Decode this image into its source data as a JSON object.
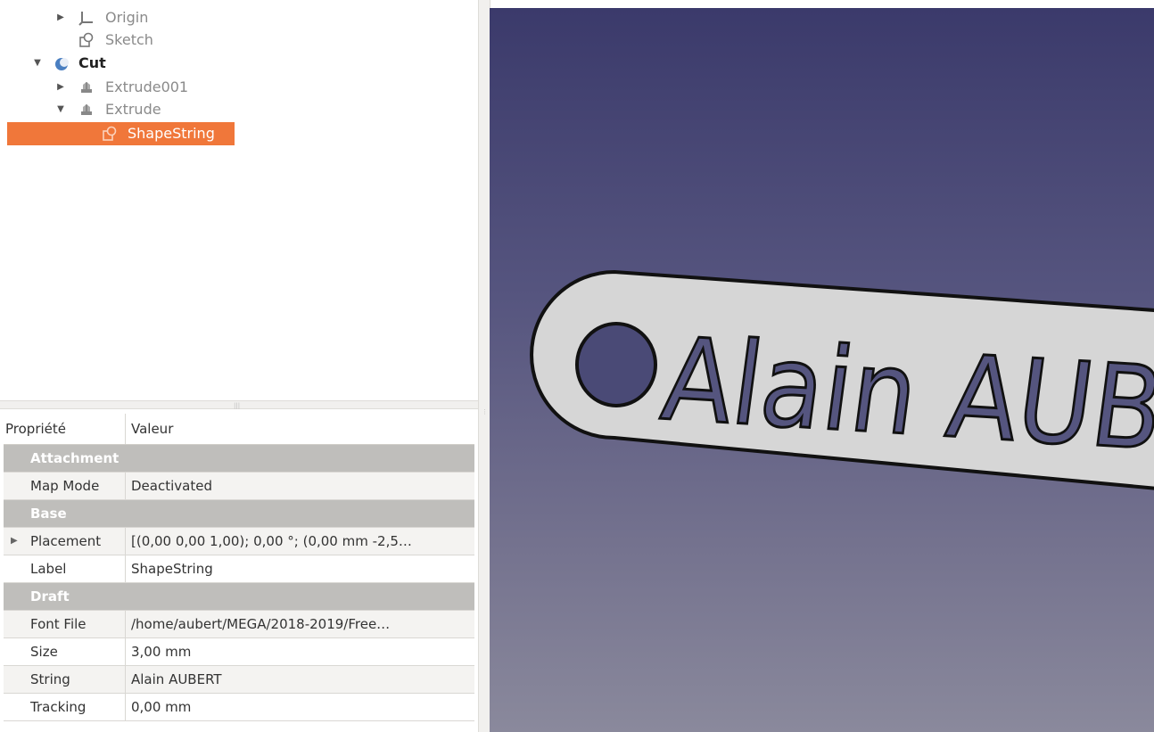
{
  "tree": {
    "items": [
      {
        "label": "Origin",
        "icon": "origin-icon",
        "expander": "▶"
      },
      {
        "label": "Sketch",
        "icon": "sketch-icon",
        "expander": ""
      },
      {
        "label": "Cut",
        "icon": "cut-icon",
        "expander": "▼"
      },
      {
        "label": "Extrude001",
        "icon": "extrude-icon",
        "expander": "▶"
      },
      {
        "label": "Extrude",
        "icon": "extrude-icon",
        "expander": "▼"
      },
      {
        "label": "ShapeString",
        "icon": "shapestring-icon",
        "expander": ""
      }
    ],
    "selected_color": "#f0773a"
  },
  "properties": {
    "header": {
      "property": "Propriété",
      "value": "Valeur"
    },
    "groups": [
      {
        "name": "Attachment",
        "rows": [
          {
            "name": "Map Mode",
            "value": "Deactivated"
          }
        ]
      },
      {
        "name": "Base",
        "rows": [
          {
            "name": "Placement",
            "value": "[(0,00 0,00 1,00); 0,00 °; (0,00 mm  -2,5…",
            "expander": "▶"
          },
          {
            "name": "Label",
            "value": "ShapeString"
          }
        ]
      },
      {
        "name": "Draft",
        "rows": [
          {
            "name": "Font File",
            "value": "/home/aubert/MEGA/2018-2019/Free…"
          },
          {
            "name": "Size",
            "value": "3,00 mm"
          },
          {
            "name": "String",
            "value": "Alain AUBERT"
          },
          {
            "name": "Tracking",
            "value": "0,00 mm"
          }
        ]
      }
    ]
  },
  "viewport": {
    "text": "Alain AUB",
    "bg_top": "#3b3a6b",
    "bg_bottom": "#8a899c",
    "part_color": "#d6d6d6"
  }
}
